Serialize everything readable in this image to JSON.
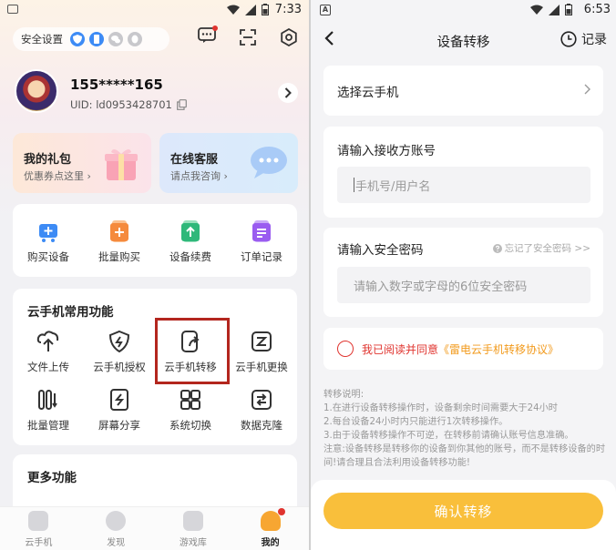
{
  "left": {
    "status_time": "7:33",
    "security_label": "安全设置",
    "user": {
      "phone": "155*****165",
      "uid": "UID: ld0953428701"
    },
    "gift_card": {
      "title": "我的礼包",
      "subtitle": "优惠券点这里 ›"
    },
    "service_card": {
      "title": "在线客服",
      "subtitle": "请点我咨询 ›"
    },
    "shop_items": [
      {
        "label": "购买设备",
        "icon": "cart-plus-icon",
        "color": "#3d8bf5"
      },
      {
        "label": "批量购买",
        "icon": "batch-buy-icon",
        "color": "#f58a3d"
      },
      {
        "label": "设备续费",
        "icon": "renew-icon",
        "color": "#2fb87a"
      },
      {
        "label": "订单记录",
        "icon": "order-record-icon",
        "color": "#9a5cf0"
      }
    ],
    "common_title": "云手机常用功能",
    "common_items": [
      {
        "label": "文件上传",
        "icon": "file-upload-icon"
      },
      {
        "label": "云手机授权",
        "icon": "authorize-icon"
      },
      {
        "label": "云手机转移",
        "icon": "transfer-icon"
      },
      {
        "label": "云手机更换",
        "icon": "replace-icon"
      },
      {
        "label": "批量管理",
        "icon": "batch-manage-icon"
      },
      {
        "label": "屏幕分享",
        "icon": "screen-share-icon"
      },
      {
        "label": "系统切换",
        "icon": "system-switch-icon"
      },
      {
        "label": "数据克隆",
        "icon": "data-clone-icon"
      }
    ],
    "more_title": "更多功能",
    "nav": [
      {
        "label": "云手机",
        "icon": "cloud-phone-icon"
      },
      {
        "label": "发现",
        "icon": "discover-icon"
      },
      {
        "label": "游戏库",
        "icon": "game-library-icon"
      },
      {
        "label": "我的",
        "icon": "profile-icon"
      }
    ]
  },
  "right": {
    "status_time": "6:53",
    "title": "设备转移",
    "record_label": "记录",
    "select_phone": "选择云手机",
    "receiver_label": "请输入接收方账号",
    "receiver_placeholder": "手机号/用户名",
    "password_label": "请输入安全密码",
    "forgot_label": "忘记了安全密码 >>",
    "password_placeholder": "请输入数字或字母的6位安全密码",
    "agree_prefix": "我已阅读并同意",
    "agree_link": "《雷电云手机转移协议》",
    "notes": [
      "转移说明:",
      "1.在进行设备转移操作时，设备剩余时间需要大于24小时",
      "2.每台设备24小时内只能进行1次转移操作。",
      "3.由于设备转移操作不可逆，在转移前请确认账号信息准确。",
      "注意:设备转移是转移你的设备到你其他的账号，而不是转移设备的时间!请合理且合法利用设备转移功能!"
    ],
    "confirm_label": "确认转移"
  }
}
